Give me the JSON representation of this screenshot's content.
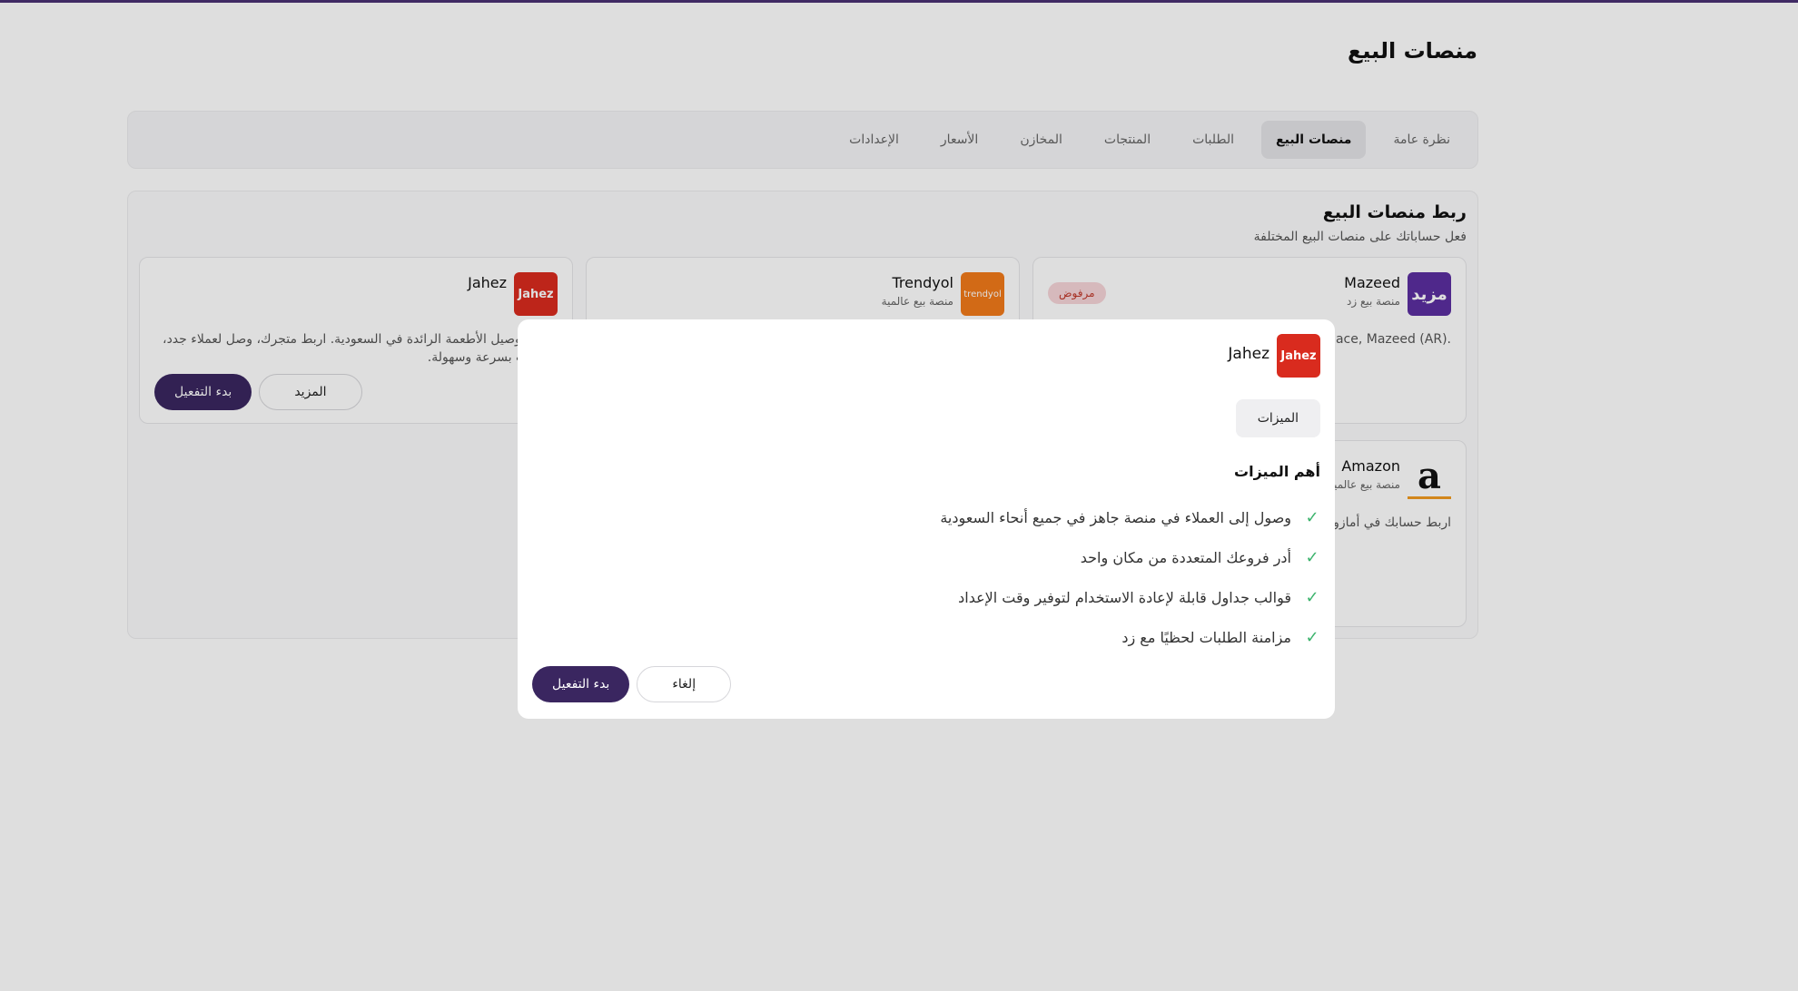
{
  "page": {
    "title": "منصات البيع"
  },
  "tabs": [
    {
      "label": "نظرة عامة",
      "active": false
    },
    {
      "label": "منصات البيع",
      "active": true
    },
    {
      "label": "الطلبات",
      "active": false
    },
    {
      "label": "المنتجات",
      "active": false
    },
    {
      "label": "المخازن",
      "active": false
    },
    {
      "label": "الأسعار",
      "active": false
    },
    {
      "label": "الإعدادات",
      "active": false
    }
  ],
  "section": {
    "title": "ربط منصات البيع",
    "subtitle": "فعل حساباتك على منصات البيع المختلفة"
  },
  "cards": {
    "mazeed": {
      "logo_text": "مزيد",
      "name": "Mazeed",
      "type": "منصة بيع زد",
      "badge": "مرفوض",
      "description": "Zid's own marketplace, Mazeed (AR).",
      "logo_color": "#5b2fa0"
    },
    "trendyol": {
      "logo_text": "trendyol",
      "name": "Trendyol",
      "type": "منصة بيع عالمية",
      "logo_color": "#f27a1a"
    },
    "jahez": {
      "logo_text": "Jahez",
      "name": "Jahez",
      "description": "منصة توصيل الأطعمة الرائدة في السعودية. اربط متجرك، وصل لعملاء جدد، الطلبات بسرعة وسهولة.",
      "more_label": "المزيد",
      "activate_label": "بدء التفعيل",
      "logo_color": "#d92b1e"
    },
    "amazon": {
      "logo_text": "a",
      "name": "Amazon",
      "type": "منصة بيع عالمية",
      "description": "اربط حسابك في أمازون ع وربط المنتجات، ومزامنة ا شحن هذه الطلبات من"
    }
  },
  "modal": {
    "logo_text": "Jahez",
    "name": "Jahez",
    "tab_label": "الميزات",
    "heading": "أهم الميزات",
    "features": [
      "وصول إلى العملاء في منصة جاهز في جميع أنحاء السعودية",
      "أدر فروعك المتعددة من مكان واحد",
      "قوالب جداول قابلة لإعادة الاستخدام لتوفير وقت الإعداد",
      "مزامنة الطلبات لحظيًا مع زد"
    ],
    "cancel_label": "إلغاء",
    "activate_label": "بدء التفعيل"
  },
  "icons": {
    "check": "check-icon"
  },
  "colors": {
    "primary": "#3a2660",
    "accent": "#4a3173",
    "check": "#3bb36c"
  }
}
